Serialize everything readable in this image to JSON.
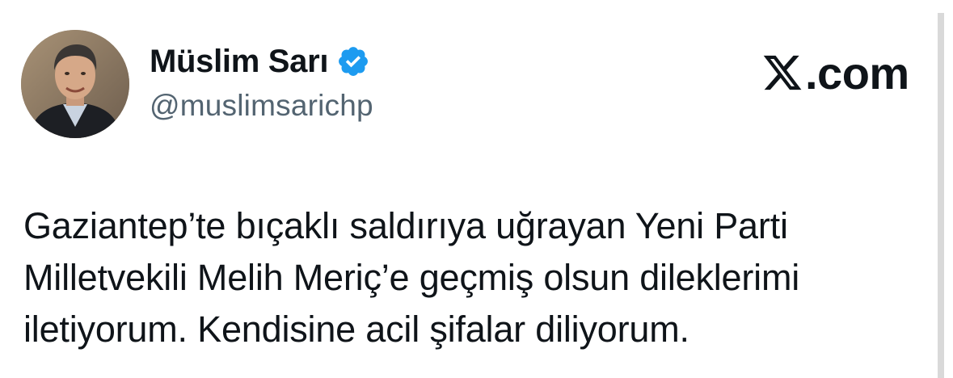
{
  "author": {
    "display_name": "Müslim Sarı",
    "handle": "@muslimsarichp",
    "verified": true,
    "verified_color": "#1d9bf0"
  },
  "brand": {
    "text": ".com",
    "logo_icon": "x-logo-icon"
  },
  "tweet": {
    "lines": [
      "Gaziantep’te bıçaklı saldırıya uğrayan Yeni Parti",
      "Milletvekili Melih Meriç’e geçmiş olsun dileklerimi",
      "iletiyorum. Kendisine acil şifalar diliyorum."
    ]
  },
  "colors": {
    "text": "#0f1419",
    "handle": "#536471",
    "divider": "#d9d9d9"
  }
}
